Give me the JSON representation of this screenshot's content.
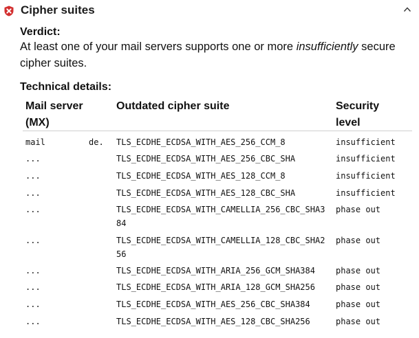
{
  "section": {
    "title": "Cipher suites",
    "status_icon": "error-shield-icon",
    "status_color": "#d32f2f",
    "toggle_icon": "chevron-up-icon"
  },
  "verdict": {
    "label": "Verdict:",
    "text_before": "At least one of your mail servers supports one or more ",
    "text_emphasis": "insufficiently",
    "text_after": " secure cipher suites."
  },
  "technical": {
    "label": "Technical details:",
    "headers": {
      "mx": "Mail server (MX)",
      "cipher": "Outdated cipher suite",
      "level": "Security level"
    },
    "rows": [
      {
        "mx": "mail",
        "domain": "de.",
        "cipher": "TLS_ECDHE_ECDSA_WITH_AES_256_CCM_8",
        "level": "insufficient"
      },
      {
        "mx": "...",
        "domain": "",
        "cipher": "TLS_ECDHE_ECDSA_WITH_AES_256_CBC_SHA",
        "level": "insufficient"
      },
      {
        "mx": "...",
        "domain": "",
        "cipher": "TLS_ECDHE_ECDSA_WITH_AES_128_CCM_8",
        "level": "insufficient"
      },
      {
        "mx": "...",
        "domain": "",
        "cipher": "TLS_ECDHE_ECDSA_WITH_AES_128_CBC_SHA",
        "level": "insufficient"
      },
      {
        "mx": "...",
        "domain": "",
        "cipher": "TLS_ECDHE_ECDSA_WITH_CAMELLIA_256_CBC_SHA384",
        "level": "phase out"
      },
      {
        "mx": "...",
        "domain": "",
        "cipher": "TLS_ECDHE_ECDSA_WITH_CAMELLIA_128_CBC_SHA256",
        "level": "phase out"
      },
      {
        "mx": "...",
        "domain": "",
        "cipher": "TLS_ECDHE_ECDSA_WITH_ARIA_256_GCM_SHA384",
        "level": "phase out"
      },
      {
        "mx": "...",
        "domain": "",
        "cipher": "TLS_ECDHE_ECDSA_WITH_ARIA_128_GCM_SHA256",
        "level": "phase out"
      },
      {
        "mx": "...",
        "domain": "",
        "cipher": "TLS_ECDHE_ECDSA_WITH_AES_256_CBC_SHA384",
        "level": "phase out"
      },
      {
        "mx": "...",
        "domain": "",
        "cipher": "TLS_ECDHE_ECDSA_WITH_AES_128_CBC_SHA256",
        "level": "phase out"
      }
    ]
  }
}
